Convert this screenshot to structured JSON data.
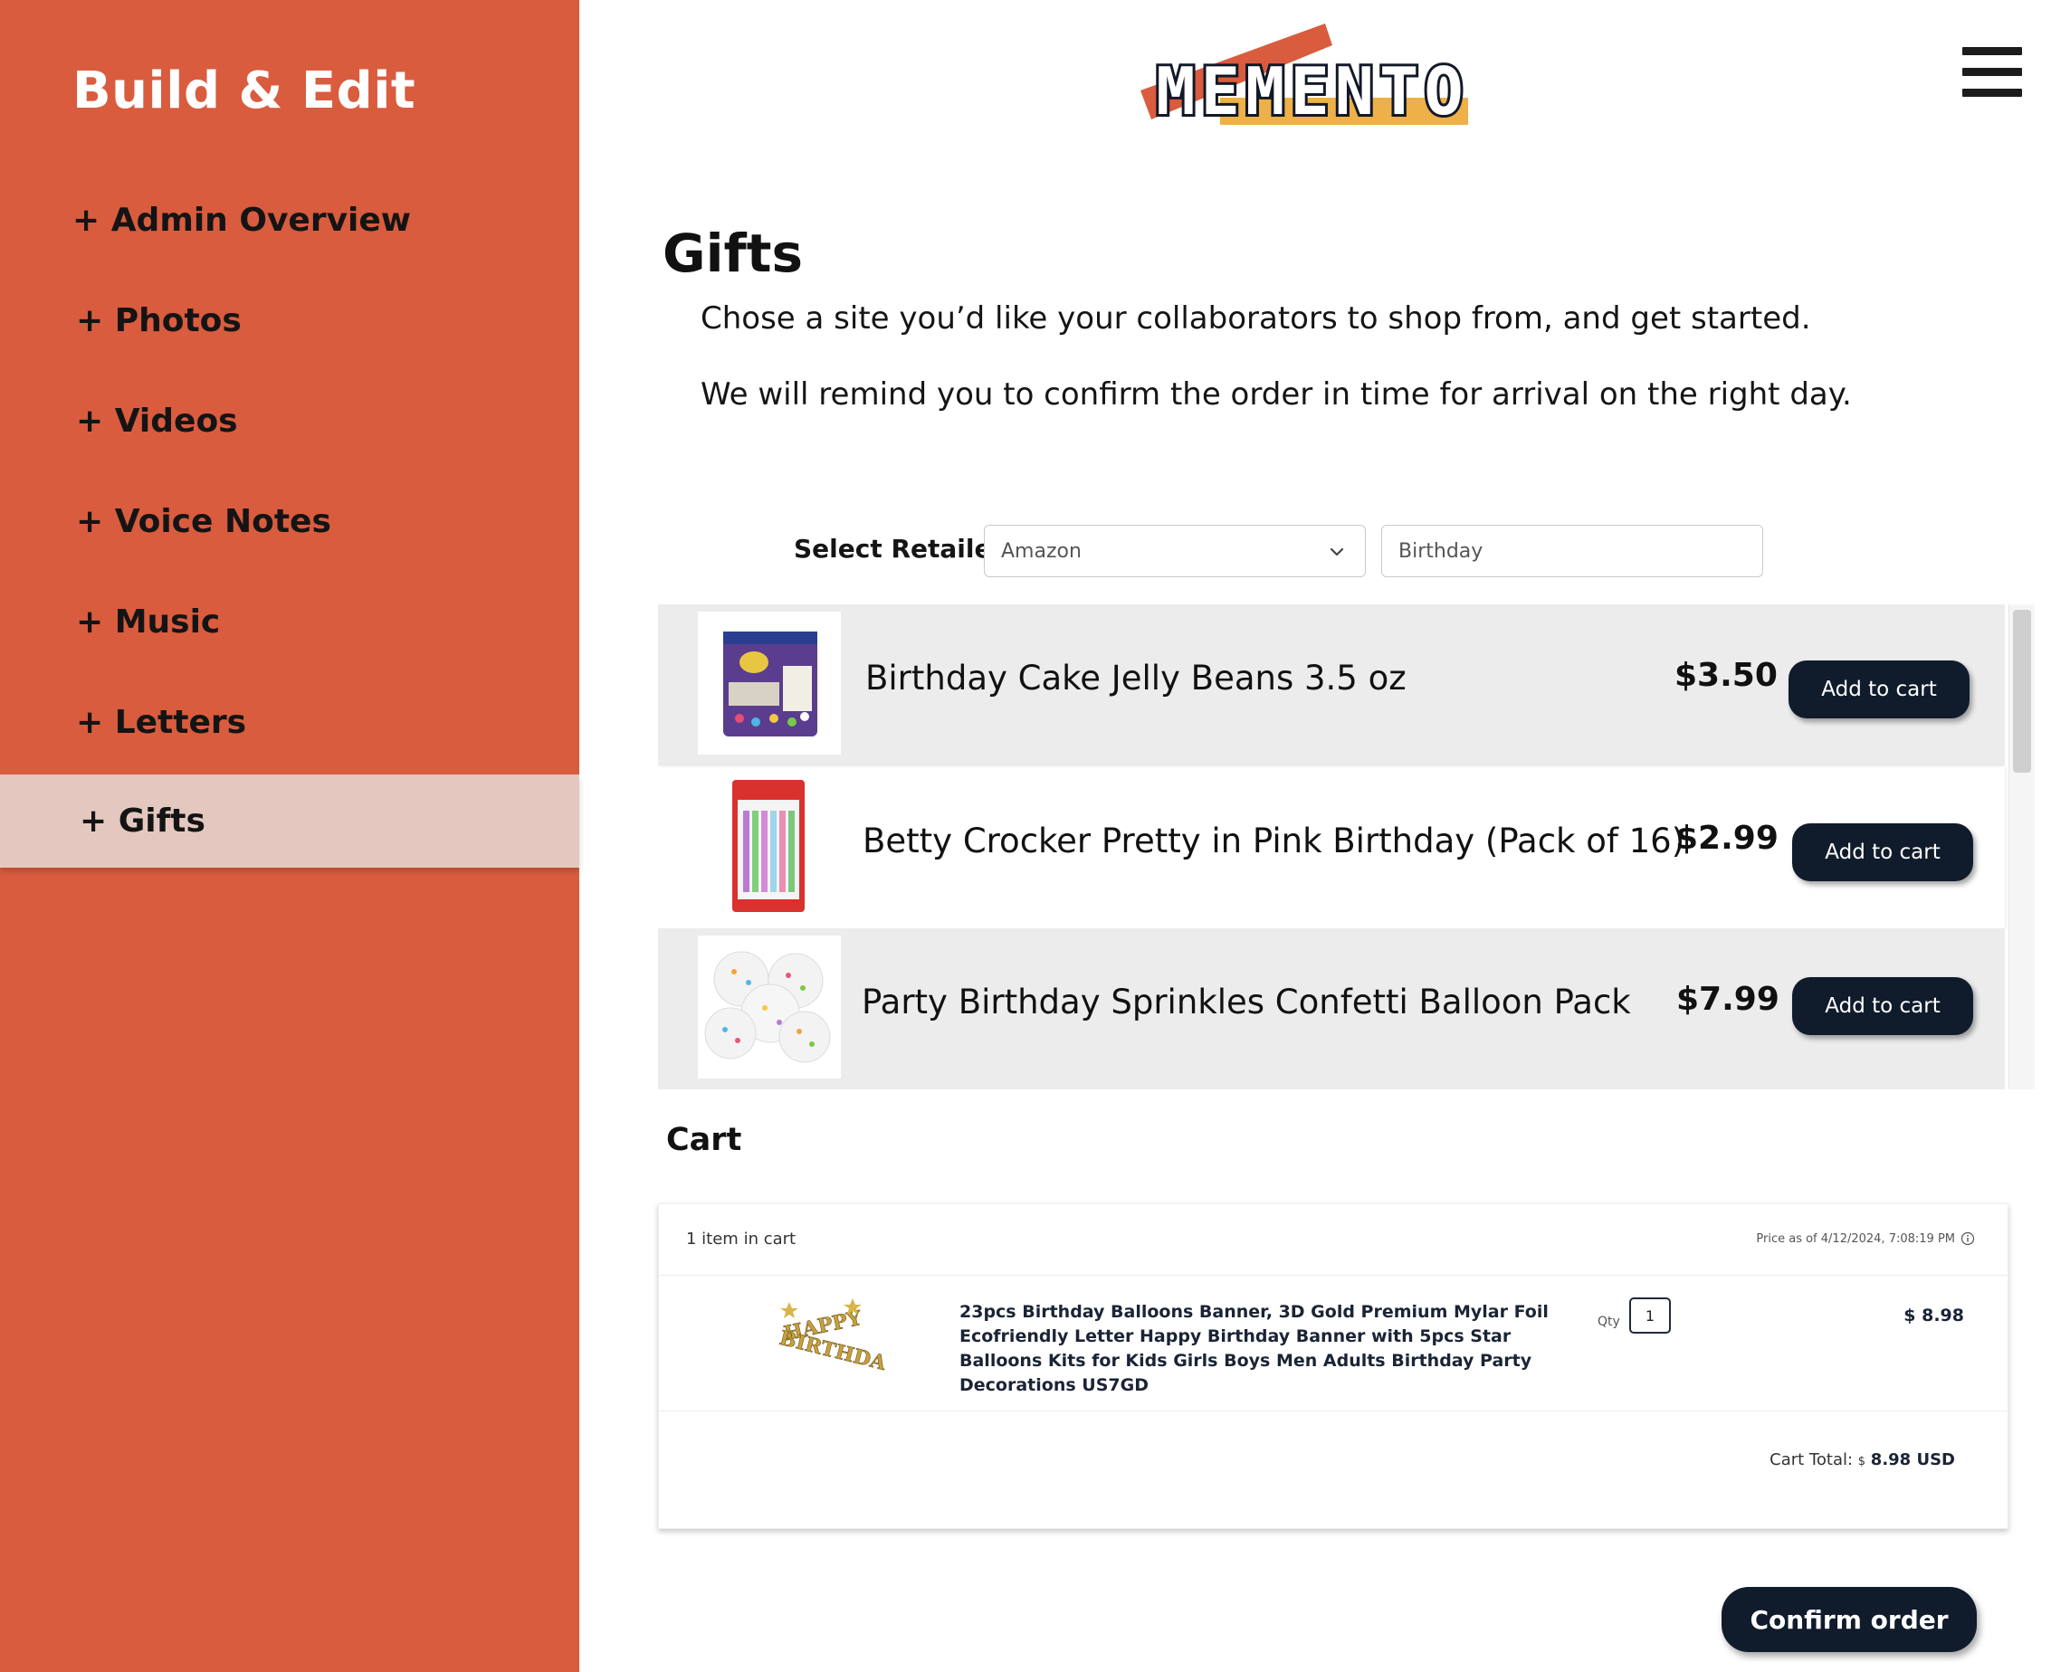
{
  "sidebar": {
    "title": "Build & Edit",
    "items": [
      {
        "label": "+ Admin Overview"
      },
      {
        "label": "+ Photos"
      },
      {
        "label": "+ Videos"
      },
      {
        "label": "+ Voice Notes"
      },
      {
        "label": "+ Music"
      },
      {
        "label": "+ Letters"
      },
      {
        "label": "+ Gifts",
        "active": true
      }
    ]
  },
  "header": {
    "logo_text": "MEMENTO",
    "menu_icon": "hamburger-menu-icon"
  },
  "main": {
    "title": "Gifts",
    "intro_1": "Chose a site you’d like your collaborators to shop from, and get started.",
    "intro_2": "We will remind you to confirm the order in time for arrival on the right day.",
    "retailer_label": "Select Retailer",
    "retailer_selected": "Amazon",
    "search_value": "Birthday"
  },
  "products": [
    {
      "name": "Birthday Cake Jelly Beans 3.5 oz",
      "price": "$3.50",
      "button": "Add to cart",
      "thumb_icon": "jelly-beans-bag-icon"
    },
    {
      "name": "Betty Crocker Pretty in Pink Birthday (Pack of 16)",
      "price": "$2.99",
      "button": "Add to cart",
      "thumb_icon": "candles-pack-icon"
    },
    {
      "name": "Party Birthday Sprinkles Confetti Balloon Pack",
      "price": "$7.99",
      "button": "Add to cart",
      "thumb_icon": "confetti-balloons-icon"
    }
  ],
  "cart": {
    "heading": "Cart",
    "count_text": "1 item in cart",
    "price_asof": "Price as of 4/12/2024, 7:08:19 PM",
    "item": {
      "name": "23pcs Birthday Balloons Banner, 3D Gold Premium Mylar Foil Ecofriendly Letter Happy Birthday Banner with 5pcs Star Balloons Kits for Kids Girls Boys Men Adults Birthday Party Decorations US7GD",
      "qty_label": "Qty",
      "qty": "1",
      "price": "$ 8.98",
      "image_text_1": "HAPPY",
      "image_text_2": "BIRTHDAY"
    },
    "total_label": "Cart Total:",
    "total_currency": "$",
    "total_value": "8.98 USD"
  },
  "confirm_label": "Confirm order",
  "colors": {
    "sidebar_bg": "#d95c3e",
    "active_item_bg": "#e4c8c0",
    "button_bg": "#101c2c",
    "logo_orange": "#d95c3e",
    "logo_yellow": "#eeb048"
  }
}
